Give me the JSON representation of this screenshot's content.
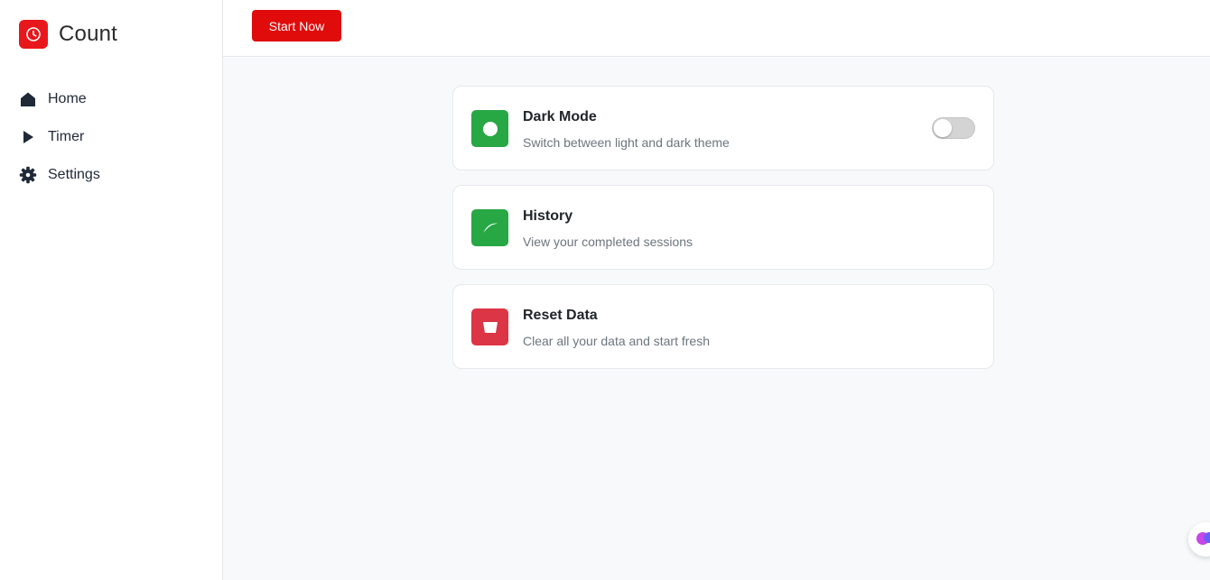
{
  "brand": {
    "name": "Count",
    "icon": "clock-icon"
  },
  "sidebar": {
    "items": [
      {
        "label": "Home",
        "icon": "home-icon"
      },
      {
        "label": "Timer",
        "icon": "play-icon"
      },
      {
        "label": "Settings",
        "icon": "gear-icon"
      }
    ]
  },
  "topbar": {
    "start_label": "Start Now"
  },
  "settings": {
    "dark_mode": {
      "title": "Dark Mode",
      "description": "Switch between light and dark theme",
      "enabled": false
    },
    "history": {
      "title": "History",
      "description": "View your completed sessions"
    },
    "reset": {
      "title": "Reset Data",
      "description": "Clear all your data and start fresh"
    }
  },
  "colors": {
    "brand": "#e8171b",
    "button": "#e00b0b",
    "green": "#28a745",
    "danger": "#dc3545",
    "toggle_off": "#d4d4d4"
  }
}
